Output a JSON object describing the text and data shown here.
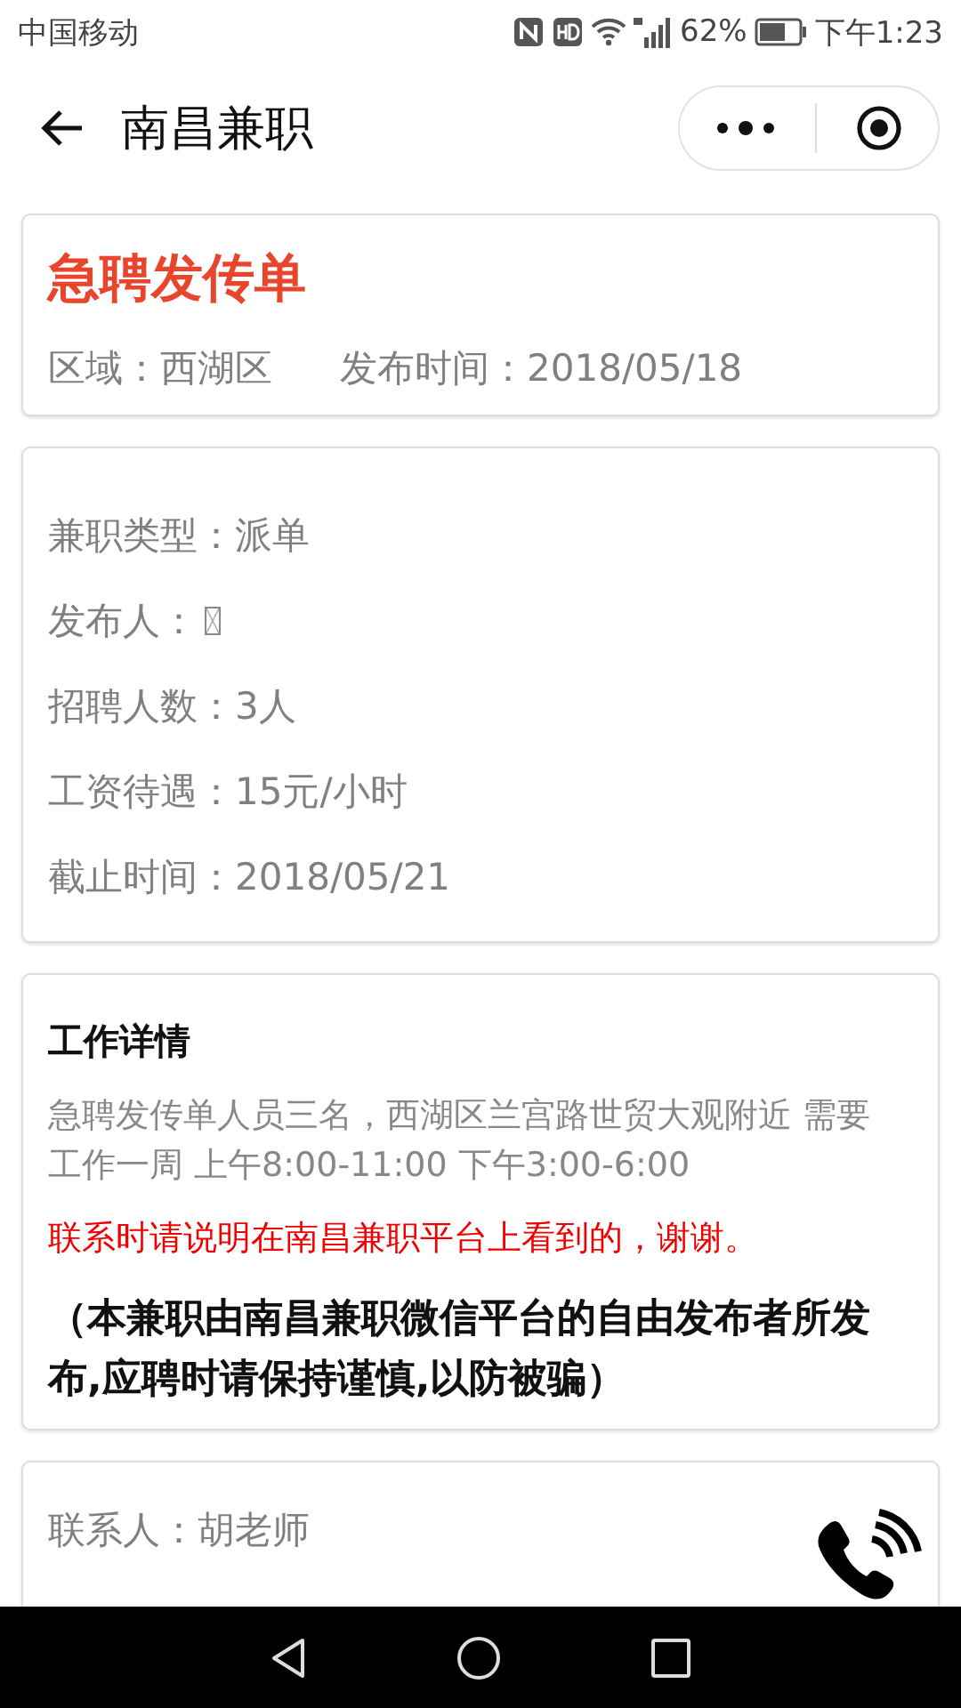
{
  "status_bar": {
    "carrier": "中国移动",
    "battery_text": "62%",
    "time": "下午1:23"
  },
  "header": {
    "title": "南昌兼职"
  },
  "summary": {
    "title": "急聘发传单",
    "area": "区域：西湖区",
    "published": "发布时间：2018/05/18"
  },
  "info": [
    {
      "label": "兼职类型：",
      "value": "派单"
    },
    {
      "label": "发布人：",
      "missing_glyph": true
    },
    {
      "label": "招聘人数：",
      "value": "3人"
    },
    {
      "label": "工资待遇：",
      "value": "15元/小时"
    },
    {
      "label": "截止时间：",
      "value": "2018/05/21"
    }
  ],
  "details": {
    "heading": "工作详情",
    "body": "急聘发传单人员三名，西湖区兰宫路世贸大观附近 需要工作一周 上午8:00-11:00 下午3:00-6:00",
    "notice": "联系时请说明在南昌兼职平台上看到的，谢谢。",
    "disclaimer": "（本兼职由南昌兼职微信平台的自由发布者所发布,应聘时请保持谨慎,以防被骗）"
  },
  "contact": {
    "person": "联系人：胡老师"
  }
}
